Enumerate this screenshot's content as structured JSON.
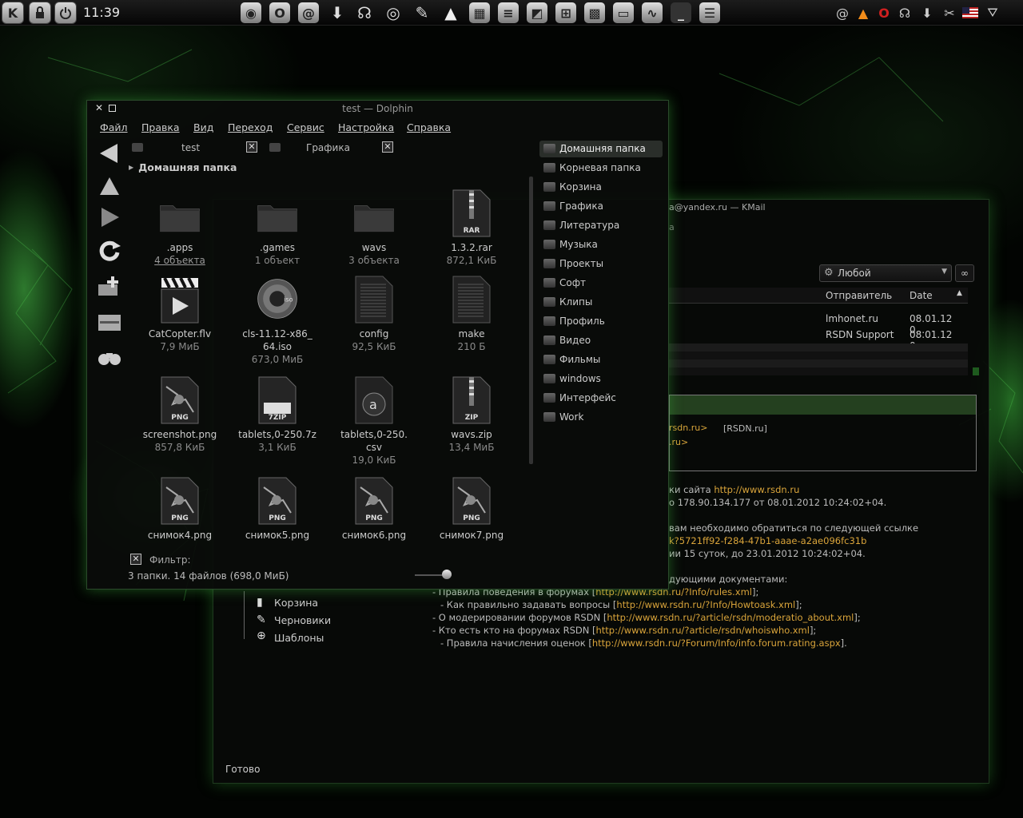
{
  "panel": {
    "clock": "11:39"
  },
  "dolphin": {
    "title": "test — Dolphin",
    "menu": [
      "Файл",
      "Правка",
      "Вид",
      "Переход",
      "Сервис",
      "Настройка",
      "Справка"
    ],
    "tabs": [
      "test",
      "Графика"
    ],
    "breadcrumb": "Домашняя папка",
    "files": [
      {
        "name": ".apps",
        "meta": [
          "4 объекта"
        ],
        "icon": "folder-icon"
      },
      {
        "name": ".games",
        "meta": [
          "1 объект"
        ],
        "icon": "folder-icon"
      },
      {
        "name": "wavs",
        "meta": [
          "3 объекта"
        ],
        "icon": "folder-icon"
      },
      {
        "name": "1.3.2.rar",
        "meta": [
          "872,1 КиБ"
        ],
        "icon": "rar-archive-icon",
        "badge": "RAR"
      },
      {
        "name": "CatCopter.flv",
        "meta": [
          "7,9 МиБ"
        ],
        "icon": "video-clapper-icon"
      },
      {
        "name": "cls-11.12-x86_",
        "name2": "64.iso",
        "meta": [
          "673,0 МиБ"
        ],
        "icon": "disc-image-icon",
        "badge": "iso"
      },
      {
        "name": "config",
        "meta": [
          "92,5 КиБ"
        ],
        "icon": "text-file-icon"
      },
      {
        "name": "make",
        "meta": [
          "210 Б"
        ],
        "icon": "text-file-icon"
      },
      {
        "name": "screenshot.png",
        "meta": [
          "857,8 КиБ"
        ],
        "icon": "png-image-icon",
        "badge": "PNG"
      },
      {
        "name": "tablets,0-250.7z",
        "meta": [
          "3,1 КиБ"
        ],
        "icon": "7zip-archive-icon",
        "badge": "7ZIP"
      },
      {
        "name": "tablets,0-250.",
        "name2": "csv",
        "meta": [
          "19,0 КиБ"
        ],
        "icon": "spreadsheet-icon",
        "badge": "a"
      },
      {
        "name": "wavs.zip",
        "meta": [
          "13,4 МиБ"
        ],
        "icon": "zip-archive-icon",
        "badge": "ZIP"
      },
      {
        "name": "снимок4.png",
        "meta": [],
        "icon": "png-image-icon",
        "badge": "PNG"
      },
      {
        "name": "снимок5.png",
        "meta": [],
        "icon": "png-image-icon",
        "badge": "PNG"
      },
      {
        "name": "снимок6.png",
        "meta": [],
        "icon": "png-image-icon",
        "badge": "PNG"
      },
      {
        "name": "снимок7.png",
        "meta": [],
        "icon": "png-image-icon",
        "badge": "PNG"
      }
    ],
    "places": [
      "Домашняя папка",
      "Корневая папка",
      "Корзина",
      "Графика",
      "Литература",
      "Музыка",
      "Проекты",
      "Софт",
      "Клипы",
      "Профиль",
      "Видео",
      "Фильмы",
      "windows",
      "Интерфейс",
      "Work"
    ],
    "filter_label": "Фильтр:",
    "status": "3 папки. 14 файлов (698,0 МиБ)"
  },
  "kmail": {
    "title": "a@yandex.ru — KMail",
    "subtitle": "a",
    "search_value": "Любой",
    "columns": {
      "sender": "Отправитель",
      "date": "Date"
    },
    "messages": [
      {
        "sender": "lmhonet.ru",
        "date": "08.01.12 0..."
      },
      {
        "sender": "RSDN Support",
        "date": "08.01.12 0..."
      }
    ],
    "header_from": "rsdn.ru>",
    "header_from_name": "[RSDN.ru]",
    "header_to": ".ru>",
    "body": [
      {
        "text": "ки сайта ",
        "link": "http://www.rsdn.ru",
        "after": ""
      },
      {
        "text": "о 178.90.134.177 от 08.01.2012 10:24:02+04.",
        "link": "",
        "after": ""
      },
      {
        "text": "вам необходимо обратиться по следующей ссылке",
        "link": "",
        "after": ""
      },
      {
        "text": "",
        "link": "k?5721ff92-f284-47b1-aaae-a2ae096fc31b",
        "after": ""
      },
      {
        "text": "ии 15 суток, до 23.01.2012 10:24:02+04.",
        "link": "",
        "after": ""
      },
      {
        "text": "дующими документами:",
        "link": "",
        "after": ""
      },
      {
        "text": "- Правила поведения в форумах [",
        "link": "http://www.rsdn.ru/?Info/rules.xml",
        "after": "];"
      },
      {
        "text": "- Как правильно задавать вопросы [",
        "link": "http://www.rsdn.ru/?Info/Howtoask.xml",
        "after": "];"
      },
      {
        "text": "- О модерировании форумов RSDN [",
        "link": "http://www.rsdn.ru/?article/rsdn/moderatio_about.xml",
        "after": "];"
      },
      {
        "text": "- Кто есть кто на форумах RSDN [",
        "link": "http://www.rsdn.ru/?article/rsdn/whoiswho.xml",
        "after": "];"
      },
      {
        "text": "- Правила начисления оценок [",
        "link": "http://www.rsdn.ru/?Forum/Info/info.forum.rating.aspx",
        "after": "]."
      }
    ],
    "folders": [
      "Корзина",
      "Черновики",
      "Шаблоны"
    ],
    "status": "Готово"
  },
  "colors": {
    "accent_green": "#2a4a2a",
    "link": "#d9a43a"
  }
}
